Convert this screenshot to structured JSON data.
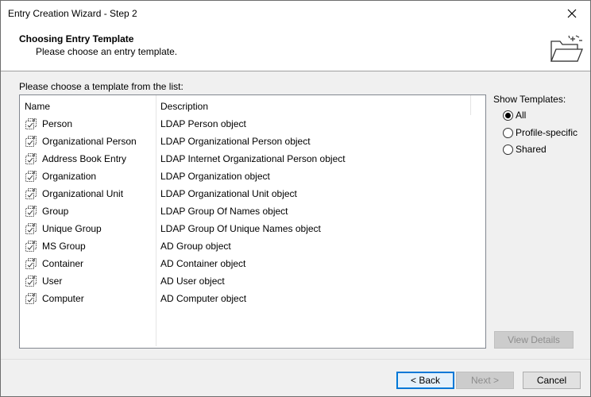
{
  "window": {
    "title": "Entry Creation Wizard - Step 2",
    "close_glyph": "✕"
  },
  "header": {
    "title": "Choosing Entry Template",
    "subtitle": "Please choose an entry template.",
    "icon": "open-folder-icon"
  },
  "list": {
    "label": "Please choose a template from the list:",
    "columns": {
      "name": "Name",
      "description": "Description"
    },
    "rows": [
      {
        "name": "Person",
        "description": "LDAP Person object"
      },
      {
        "name": "Organizational Person",
        "description": "LDAP Organizational Person object"
      },
      {
        "name": "Address Book Entry",
        "description": "LDAP Internet Organizational Person object"
      },
      {
        "name": "Organization",
        "description": "LDAP Organization object"
      },
      {
        "name": "Organizational Unit",
        "description": "LDAP Organizational Unit object"
      },
      {
        "name": "Group",
        "description": "LDAP Group Of Names object"
      },
      {
        "name": "Unique Group",
        "description": "LDAP Group Of Unique Names object"
      },
      {
        "name": "MS Group",
        "description": "AD Group object"
      },
      {
        "name": "Container",
        "description": "AD Container object"
      },
      {
        "name": "User",
        "description": "AD User object"
      },
      {
        "name": "Computer",
        "description": "AD Computer object"
      }
    ]
  },
  "show_templates": {
    "label": "Show Templates:",
    "options": [
      {
        "label": "All",
        "checked": true
      },
      {
        "label": "Profile-specific",
        "checked": false
      },
      {
        "label": "Shared",
        "checked": false
      }
    ]
  },
  "buttons": {
    "view_details": "View Details",
    "back": "< Back",
    "next": "Next >",
    "cancel": "Cancel"
  }
}
